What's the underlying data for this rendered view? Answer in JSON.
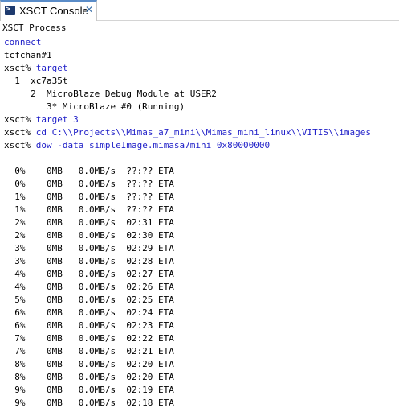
{
  "tab": {
    "title": "XSCT Console",
    "icon": "console-icon",
    "close_glyph": "✕"
  },
  "process_label": "XSCT Process",
  "colors": {
    "command": "#1f1fc8",
    "output": "#000000",
    "tab_accent": "#5a8cc8"
  },
  "console_lines": [
    {
      "prompt": "",
      "text": "connect",
      "kind": "command"
    },
    {
      "prompt": "",
      "text": "tcfchan#1",
      "kind": "output"
    },
    {
      "prompt": "xsct% ",
      "text": "target",
      "kind": "command"
    },
    {
      "prompt": "",
      "text": "  1  xc7a35t",
      "kind": "output"
    },
    {
      "prompt": "",
      "text": "     2  MicroBlaze Debug Module at USER2",
      "kind": "output"
    },
    {
      "prompt": "",
      "text": "        3* MicroBlaze #0 (Running)",
      "kind": "output"
    },
    {
      "prompt": "xsct% ",
      "text": "target 3",
      "kind": "command"
    },
    {
      "prompt": "xsct% ",
      "text": "cd C:\\\\Projects\\\\Mimas_a7_mini\\\\Mimas_mini_linux\\\\VITIS\\\\images",
      "kind": "command"
    },
    {
      "prompt": "xsct% ",
      "text": "dow -data simpleImage.mimasa7mini 0x80000000",
      "kind": "command"
    },
    {
      "prompt": "",
      "text": "",
      "kind": "output"
    },
    {
      "prompt": "",
      "text": "  0%    0MB   0.0MB/s  ??:?? ETA",
      "kind": "output"
    },
    {
      "prompt": "",
      "text": "  0%    0MB   0.0MB/s  ??:?? ETA",
      "kind": "output"
    },
    {
      "prompt": "",
      "text": "  1%    0MB   0.0MB/s  ??:?? ETA",
      "kind": "output"
    },
    {
      "prompt": "",
      "text": "  1%    0MB   0.0MB/s  ??:?? ETA",
      "kind": "output"
    },
    {
      "prompt": "",
      "text": "  2%    0MB   0.0MB/s  02:31 ETA",
      "kind": "output"
    },
    {
      "prompt": "",
      "text": "  2%    0MB   0.0MB/s  02:30 ETA",
      "kind": "output"
    },
    {
      "prompt": "",
      "text": "  3%    0MB   0.0MB/s  02:29 ETA",
      "kind": "output"
    },
    {
      "prompt": "",
      "text": "  3%    0MB   0.0MB/s  02:28 ETA",
      "kind": "output"
    },
    {
      "prompt": "",
      "text": "  4%    0MB   0.0MB/s  02:27 ETA",
      "kind": "output"
    },
    {
      "prompt": "",
      "text": "  4%    0MB   0.0MB/s  02:26 ETA",
      "kind": "output"
    },
    {
      "prompt": "",
      "text": "  5%    0MB   0.0MB/s  02:25 ETA",
      "kind": "output"
    },
    {
      "prompt": "",
      "text": "  6%    0MB   0.0MB/s  02:24 ETA",
      "kind": "output"
    },
    {
      "prompt": "",
      "text": "  6%    0MB   0.0MB/s  02:23 ETA",
      "kind": "output"
    },
    {
      "prompt": "",
      "text": "  7%    0MB   0.0MB/s  02:22 ETA",
      "kind": "output"
    },
    {
      "prompt": "",
      "text": "  7%    0MB   0.0MB/s  02:21 ETA",
      "kind": "output"
    },
    {
      "prompt": "",
      "text": "  8%    0MB   0.0MB/s  02:20 ETA",
      "kind": "output"
    },
    {
      "prompt": "",
      "text": "  8%    0MB   0.0MB/s  02:20 ETA",
      "kind": "output"
    },
    {
      "prompt": "",
      "text": "  9%    0MB   0.0MB/s  02:19 ETA",
      "kind": "output"
    },
    {
      "prompt": "",
      "text": "  9%    0MB   0.0MB/s  02:18 ETA",
      "kind": "output"
    }
  ]
}
